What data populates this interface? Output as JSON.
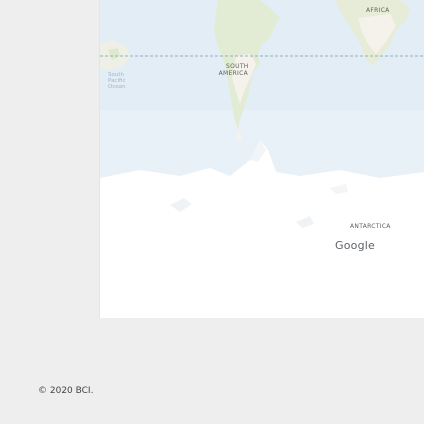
{
  "map": {
    "labels": {
      "africa": "AFRICA",
      "south_america_line1": "SOUTH",
      "south_america_line2": "AMERICA",
      "antarctica": "ANTARCTICA",
      "south_pacific_line1": "South",
      "south_pacific_line2": "Pacific",
      "south_pacific_line3": "Ocean"
    },
    "provider": "Google",
    "colors": {
      "water": "#e7f0f8",
      "land": "#f3f1ea",
      "land_green": "#e3ecd4",
      "ice": "#ffffff",
      "tropic_line": "#7a9bb8"
    }
  },
  "footer": {
    "copyright": "© 2020 BCI."
  }
}
